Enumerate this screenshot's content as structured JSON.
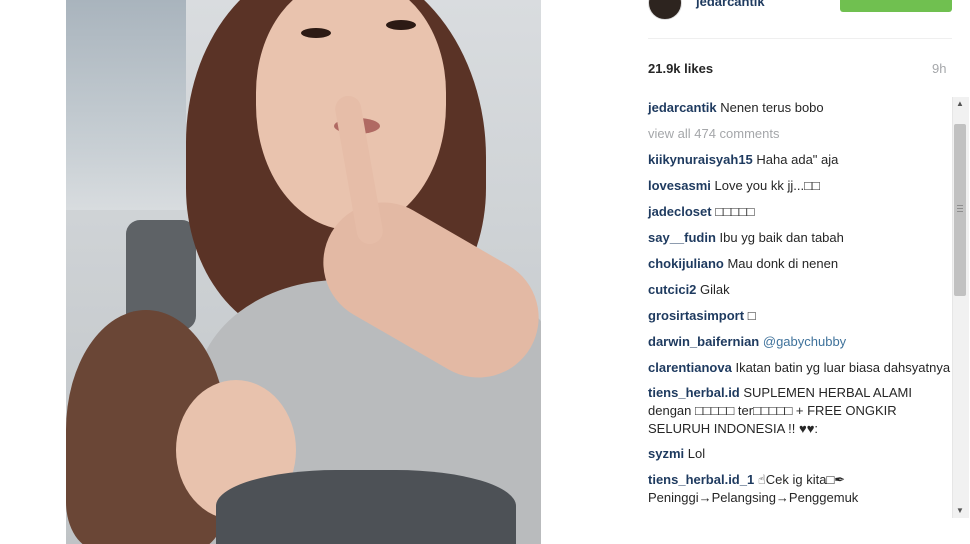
{
  "post": {
    "username": "jedarcantik",
    "likes": "21.9k likes",
    "time": "9h",
    "view_all": "view all 474 comments",
    "comments": [
      {
        "user": "jedarcantik",
        "text": "Nenen terus bobo"
      },
      {
        "user": "kiikynuraisyah15",
        "text": "Haha ada\" aja"
      },
      {
        "user": "lovesasmi",
        "text": "Love you kk jj...□□"
      },
      {
        "user": "jadecloset",
        "text": "□□□□□"
      },
      {
        "user": "say__fudin",
        "text": "Ibu yg baik dan tabah"
      },
      {
        "user": "chokijuliano",
        "text": "Mau donk di nenen"
      },
      {
        "user": "cutcici2",
        "text": "Gilak"
      },
      {
        "user": "grosirtasimport",
        "text": "□"
      },
      {
        "user": "darwin_baifernian",
        "text": "",
        "mention": "@gabychubby"
      },
      {
        "user": "clarentianova",
        "text": "Ikatan batin yg luar biasa dahsyatnya"
      },
      {
        "user": "tiens_herbal.id",
        "text": "SUPLEMEN HERBAL ALAMI dengan □□□□□ ter□□□□□ + FREE ONGKIR SELURUH INDONESIA !! ♥♥:"
      },
      {
        "user": "syzmi",
        "text": "Lol"
      },
      {
        "user": "tiens_herbal.id_1",
        "text": "☝︎Cek ig kita□✒ Peninggi→Pelangsing→Penggemuk"
      }
    ]
  },
  "colors": {
    "follow": "#70c050",
    "username": "#1e3a5f",
    "muted": "#a5a7aa"
  },
  "icons": {
    "scroll_up": "▲",
    "scroll_down": "▼"
  }
}
